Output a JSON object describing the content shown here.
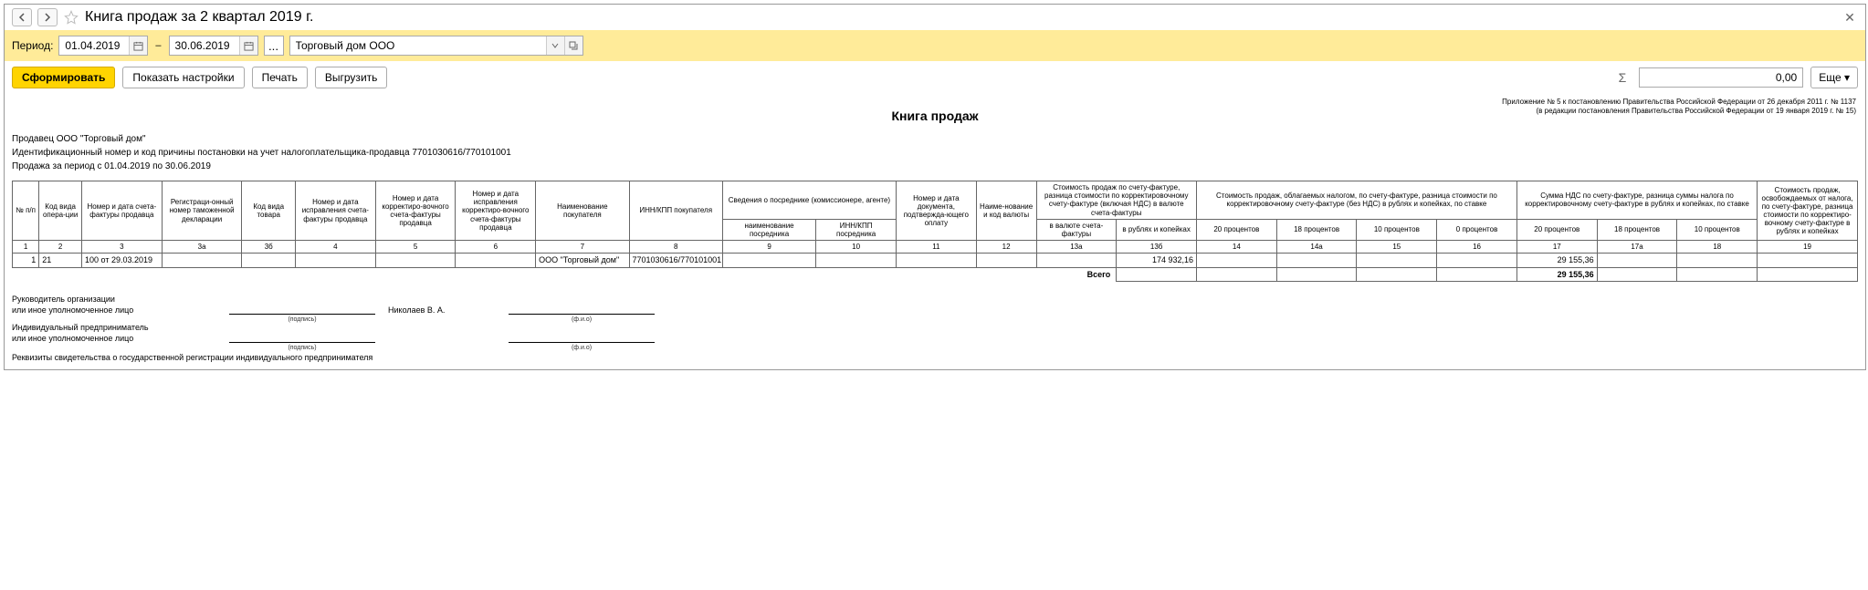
{
  "title": "Книга продаж за 2 квартал 2019 г.",
  "filter": {
    "period_label": "Период:",
    "date_from": "01.04.2019",
    "date_to": "30.06.2019",
    "dash": "–",
    "dots": "...",
    "org": "Торговый дом ООО"
  },
  "toolbar": {
    "generate": "Сформировать",
    "settings": "Показать настройки",
    "print": "Печать",
    "export": "Выгрузить",
    "sum_symbol": "Σ",
    "sum_value": "0,00",
    "more": "Еще"
  },
  "legal": {
    "line1": "Приложение № 5 к постановлению Правительства Российской Федерации от 26 декабря 2011 г. № 1137",
    "line2": "(в редакции постановления Правительства Российской Федерации от 19 января 2019 г. № 15)"
  },
  "report": {
    "title": "Книга продаж",
    "seller": "Продавец  ООО \"Торговый дом\"",
    "inn_kpp": "Идентификационный номер и код причины постановки на учет налогоплательщика-продавца  7701030616/770101001",
    "period": "Продажа за период с 01.04.2019 по 30.06.2019"
  },
  "columns": {
    "c1": "№ п/п",
    "c2": "Код вида опера-ции",
    "c3": "Номер и дата счета-фактуры продавца",
    "c3a": "Регистраци-онный номер таможенной декларации",
    "c3b": "Код вида товара",
    "c4": "Номер и дата исправления счета-фактуры продавца",
    "c5": "Номер и дата корректиро-вочного счета-фактуры продавца",
    "c6": "Номер и дата исправления корректиро-вочного счета-фактуры продавца",
    "c7": "Наименование покупателя",
    "c8": "ИНН/КПП покупателя",
    "c9_10": "Сведения о посреднике (комиссионере, агенте)",
    "c9": "наименование посредника",
    "c10": "ИНН/КПП посредника",
    "c11": "Номер и дата документа, подтвержда-ющего оплату",
    "c12": "Наиме-нование и код валюты",
    "c13": "Стоимость продаж по счету-фактуре, разница стоимости по корректировочному счету-фактуре (включая НДС) в валюте счета-фактуры",
    "c13a": "в валюте счета-фактуры",
    "c13b": "в рублях и копейках",
    "c14_16": "Стоимость продаж, облагаемых налогом, по счету-фактуре, разница стоимости по корректировочному счету-фактуре (без НДС) в рублях и копейках, по ставке",
    "c14": "20 процентов",
    "c14a": "18 процентов",
    "c15": "10 процентов",
    "c16": "0 процентов",
    "c17_18": "Сумма НДС по счету-фактуре, разница суммы налога по корректировочному счету-фактуре в рублях и копейках, по ставке",
    "c17": "20 процентов",
    "c17a": "18 процентов",
    "c18": "10 процентов",
    "c19": "Стоимость продаж, освобождаемых от налога, по счету-фактуре, разница стоимости по корректиро-вочному счету-фактуре в рублях и копейках"
  },
  "colnums": {
    "n1": "1",
    "n2": "2",
    "n3": "3",
    "n3a": "3а",
    "n3b": "3б",
    "n4": "4",
    "n5": "5",
    "n6": "6",
    "n7": "7",
    "n8": "8",
    "n9": "9",
    "n10": "10",
    "n11": "11",
    "n12": "12",
    "n13a": "13а",
    "n13b": "13б",
    "n14": "14",
    "n14a": "14а",
    "n15": "15",
    "n16": "16",
    "n17": "17",
    "n17a": "17а",
    "n18": "18",
    "n19": "19"
  },
  "rows": [
    {
      "n": "1",
      "code": "21",
      "invoice": "100 от 29.03.2019",
      "buyer": "ООО \"Торговый дом\"",
      "buyer_inn": "7701030616/770101001",
      "sum_rub": "174 932,16",
      "vat20": "29 155,36"
    }
  ],
  "totals": {
    "label": "Всего",
    "vat20": "29 155,36"
  },
  "sign": {
    "head1": "Руководитель организации",
    "head2": "или иное уполномоченное лицо",
    "ip1": "Индивидуальный предприниматель",
    "ip2": "или иное уполномоченное лицо",
    "podpis": "(подпись)",
    "fio": "(ф.и.о)",
    "name": "Николаев В. А.",
    "req": "Реквизиты свидетельства о государственной регистрации индивидуального предпринимателя"
  }
}
